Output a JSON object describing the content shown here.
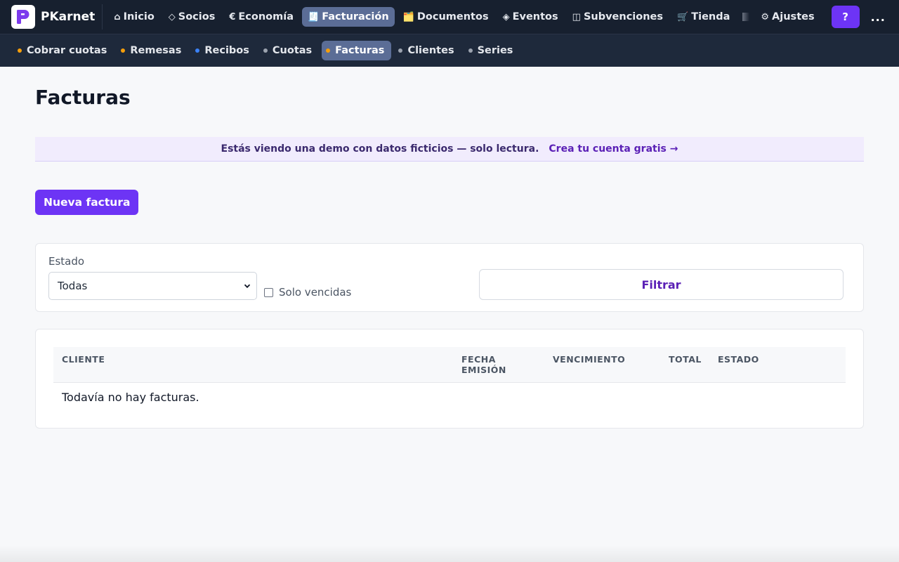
{
  "brand": {
    "name": "PKarnet"
  },
  "topnav": {
    "items": [
      {
        "label": "Inicio",
        "icon": "⌂"
      },
      {
        "label": "Socios",
        "icon": "◇"
      },
      {
        "label": "Economía",
        "icon": "€"
      },
      {
        "label": "Facturación",
        "icon": "🧾"
      },
      {
        "label": "Documentos",
        "icon": "🗂️"
      },
      {
        "label": "Eventos",
        "icon": "◈"
      },
      {
        "label": "Subvenciones",
        "icon": "◫"
      },
      {
        "label": "Tienda",
        "icon": "🛒"
      },
      {
        "label": "Ajustes",
        "icon": "⚙"
      }
    ],
    "help_label": "?",
    "more_label": "..."
  },
  "subnav": {
    "items": [
      {
        "label": "Cobrar cuotas",
        "dot_color": "#f59e0b"
      },
      {
        "label": "Remesas",
        "dot_color": "#f59e0b"
      },
      {
        "label": "Recibos",
        "dot_color": "#3b82f6"
      },
      {
        "label": "Cuotas",
        "dot_color": "#9ca3af"
      },
      {
        "label": "Facturas",
        "dot_color": "#f59e0b"
      },
      {
        "label": "Clientes",
        "dot_color": "#9ca3af"
      },
      {
        "label": "Series",
        "dot_color": "#9ca3af"
      }
    ]
  },
  "page": {
    "title": "Facturas"
  },
  "banner": {
    "text": "Estás viendo una demo con datos ficticios — solo lectura.",
    "link": "Crea tu cuenta gratis →"
  },
  "actions": {
    "new_invoice": "Nueva factura"
  },
  "filters": {
    "estado_label": "Estado",
    "estado_value": "Todas",
    "solo_vencidas_label": "Solo vencidas",
    "solo_vencidas_checked": false,
    "filter_button": "Filtrar"
  },
  "table": {
    "columns": [
      "CLIENTE",
      "FECHA EMISIÓN",
      "VENCIMIENTO",
      "TOTAL",
      "ESTADO"
    ],
    "empty_message": "Todavía no hay facturas."
  },
  "colors": {
    "accent": "#6d34f5",
    "topbar": "#17202f",
    "subnav": "#1e293b",
    "active_nav": "#5b6d96"
  }
}
